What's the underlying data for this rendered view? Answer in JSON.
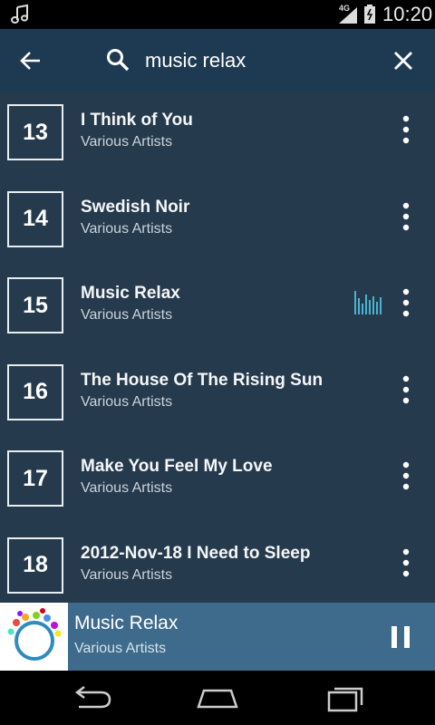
{
  "status_bar": {
    "network": "4G",
    "time": "10:20",
    "icons": [
      "music-note-icon",
      "signal-icon",
      "battery-icon"
    ]
  },
  "header": {
    "back_icon": "arrow-left-icon",
    "search_icon": "search-icon",
    "search_value": "music relax",
    "close_icon": "close-icon"
  },
  "tracks": [
    {
      "number": "13",
      "title": "I Think of You",
      "artist": "Various Artists",
      "playing": false
    },
    {
      "number": "14",
      "title": "Swedish Noir",
      "artist": "Various Artists",
      "playing": false
    },
    {
      "number": "15",
      "title": "Music Relax",
      "artist": "Various Artists",
      "playing": true
    },
    {
      "number": "16",
      "title": "The House Of The Rising Sun",
      "artist": "Various Artists",
      "playing": false
    },
    {
      "number": "17",
      "title": "Make You Feel My Love",
      "artist": "Various Artists",
      "playing": false
    },
    {
      "number": "18",
      "title": "2012-Nov-18 I Need to Sleep",
      "artist": "Various Artists",
      "playing": false
    }
  ],
  "now_playing": {
    "title": "Music Relax",
    "artist": "Various Artists",
    "control_icon": "pause-icon"
  },
  "colors": {
    "header_bg": "#1e3a52",
    "list_bg": "#263a4d",
    "now_playing_bg": "#3e6b8c",
    "accent": "#4ab3d1"
  },
  "nav_bar": {
    "icons": [
      "back-nav-icon",
      "home-nav-icon",
      "recents-nav-icon"
    ]
  }
}
